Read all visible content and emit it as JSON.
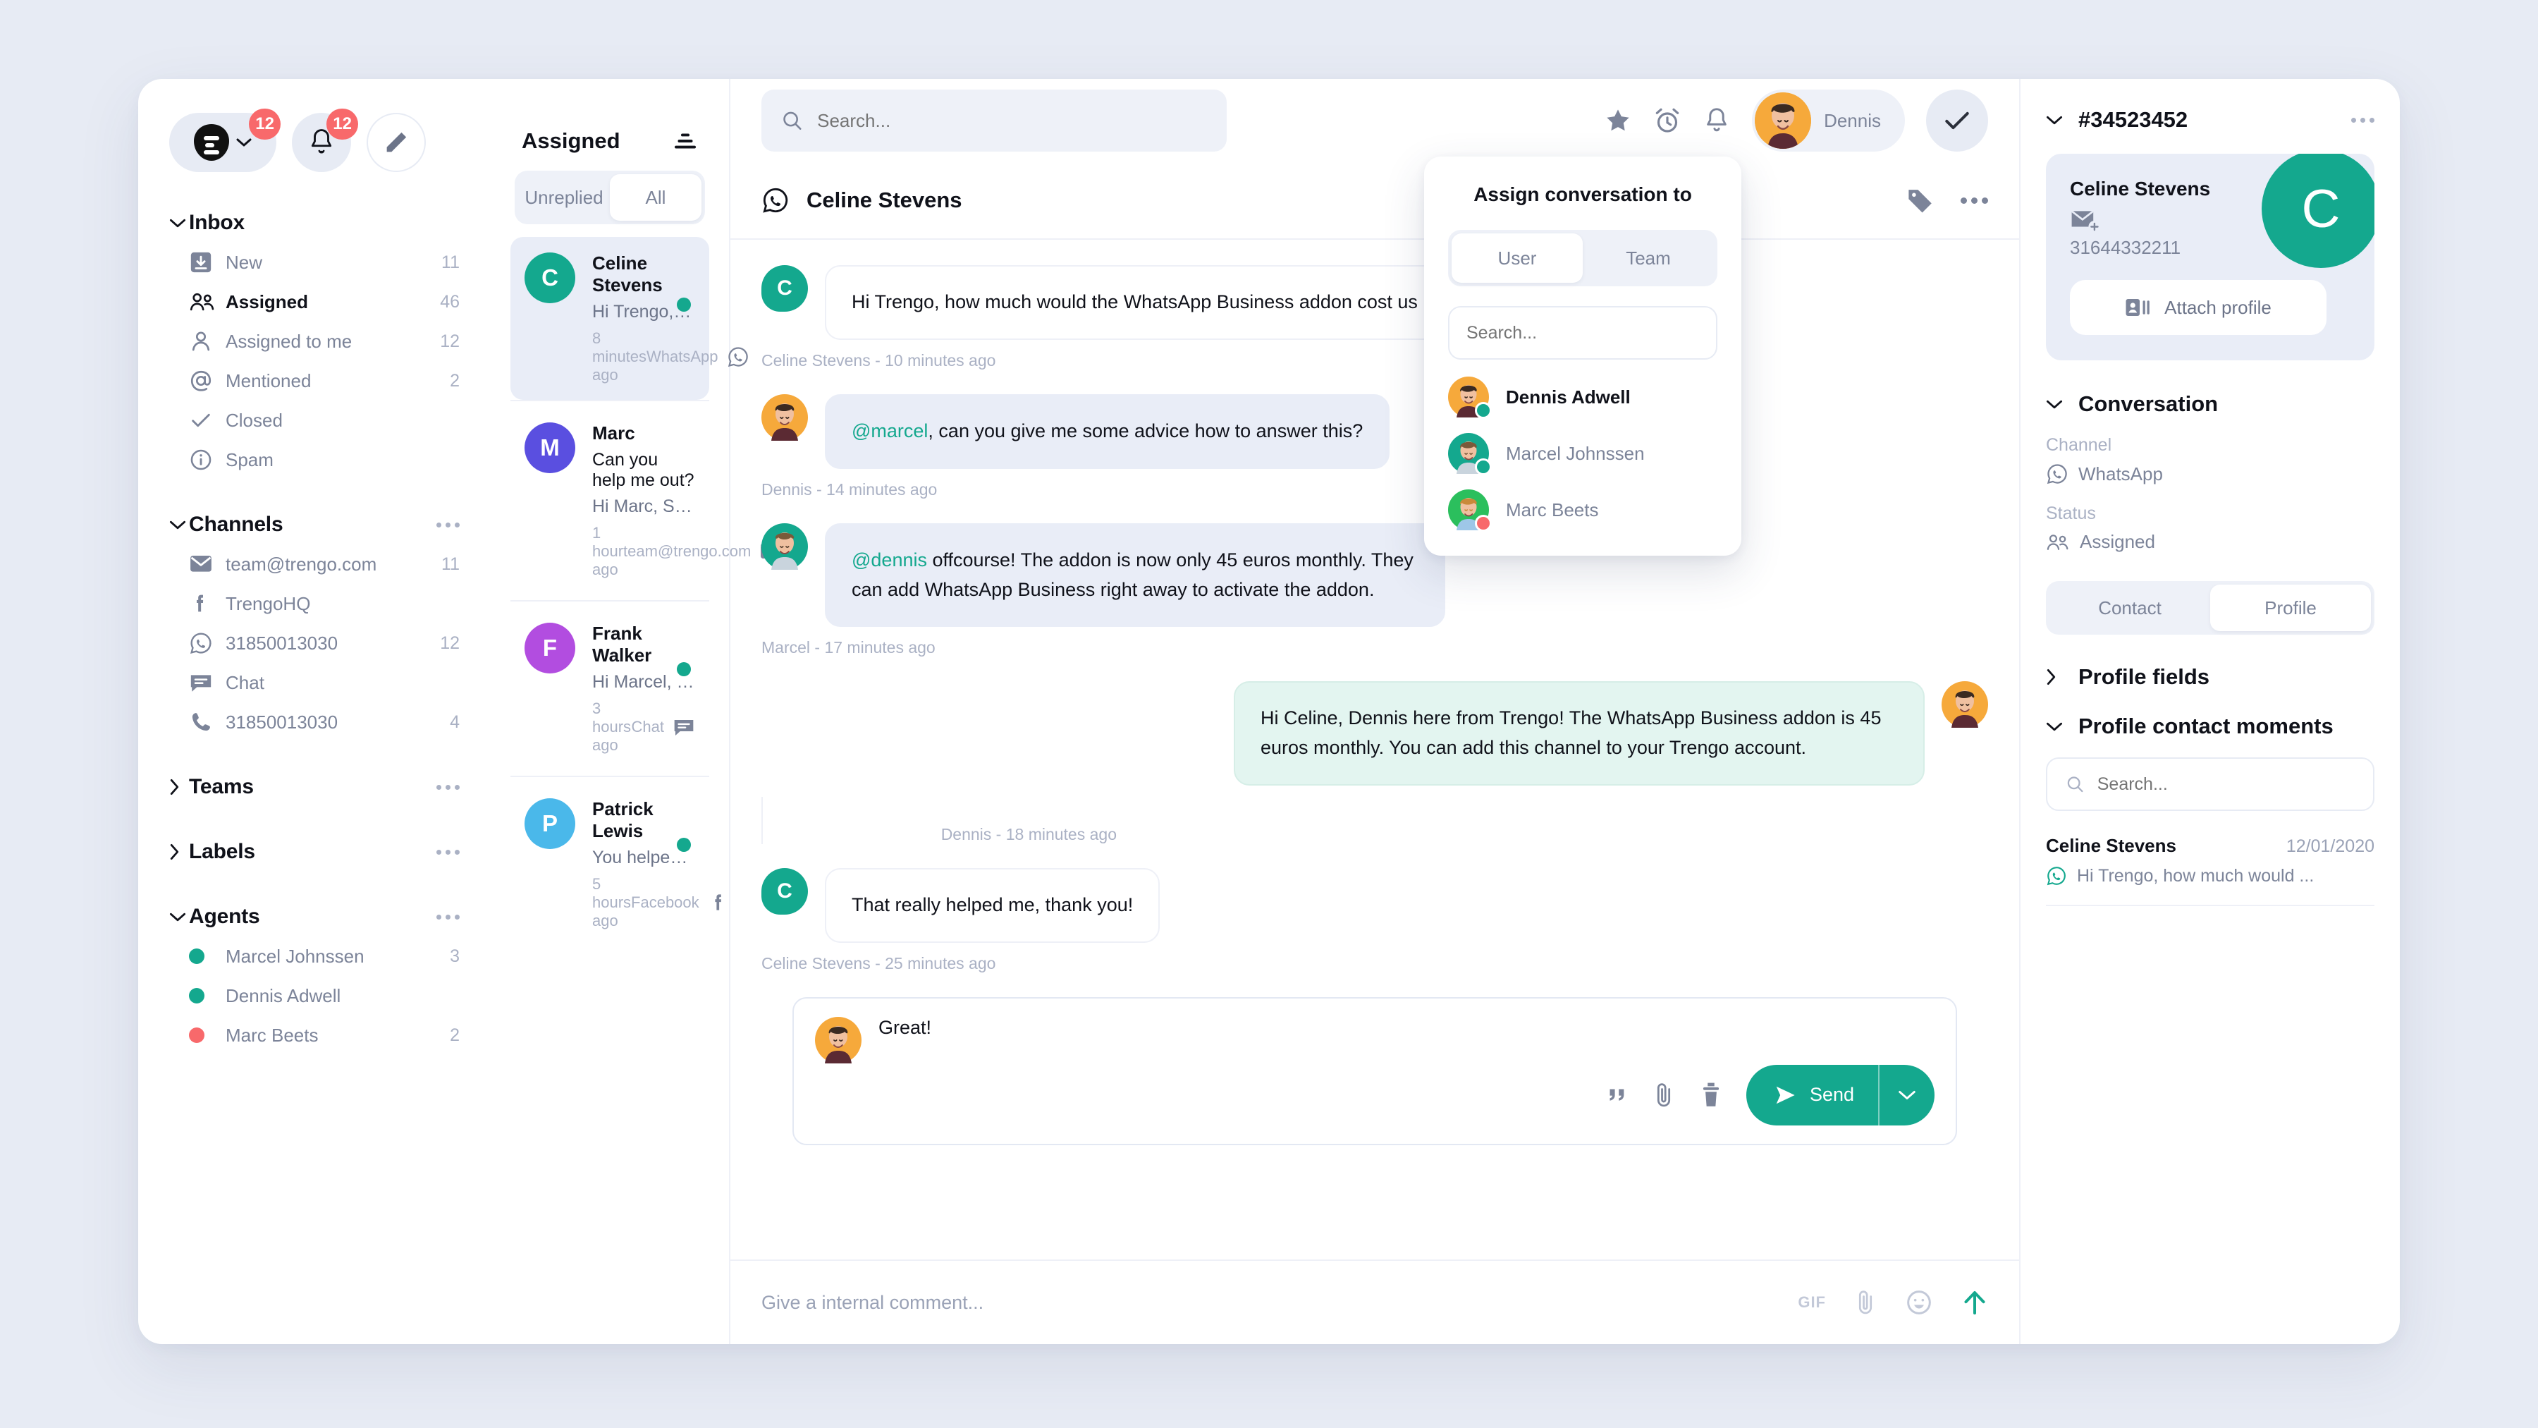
{
  "colors": {
    "accent": "#14a88e",
    "page_bg": "#e7ebf4",
    "badge_red": "#f8696b",
    "outgoing_bubble": "#e3f5f0",
    "note_bubble": "#e9edf7"
  },
  "topnav": {
    "logo_badge": "12",
    "bell_badge": "12",
    "compose_icon": "pencil-icon"
  },
  "search": {
    "placeholder": "Search..."
  },
  "sidebar": {
    "sections": [
      {
        "key": "inbox",
        "title": "Inbox",
        "expanded": true,
        "has_more": false,
        "items": [
          {
            "icon": "inbox-download-icon",
            "label": "New",
            "count": "11",
            "active": false
          },
          {
            "icon": "users-icon",
            "label": "Assigned",
            "count": "46",
            "active": true
          },
          {
            "icon": "user-icon",
            "label": "Assigned to me",
            "count": "12",
            "active": false
          },
          {
            "icon": "at-icon",
            "label": "Mentioned",
            "count": "2",
            "active": false
          },
          {
            "icon": "check-icon",
            "label": "Closed",
            "count": "",
            "active": false
          },
          {
            "icon": "info-icon",
            "label": "Spam",
            "count": "",
            "active": false
          }
        ]
      },
      {
        "key": "channels",
        "title": "Channels",
        "expanded": true,
        "has_more": true,
        "items": [
          {
            "icon": "email-icon",
            "label": "team@trengo.com",
            "count": "11",
            "active": false
          },
          {
            "icon": "facebook-icon",
            "label": "TrengoHQ",
            "count": "",
            "active": false
          },
          {
            "icon": "whatsapp-icon",
            "label": "31850013030",
            "count": "12",
            "active": false
          },
          {
            "icon": "chat-icon",
            "label": "Chat",
            "count": "",
            "active": false
          },
          {
            "icon": "phone-icon",
            "label": "31850013030",
            "count": "4",
            "active": false
          }
        ]
      },
      {
        "key": "teams",
        "title": "Teams",
        "expanded": false,
        "has_more": true,
        "items": []
      },
      {
        "key": "labels",
        "title": "Labels",
        "expanded": false,
        "has_more": true,
        "items": []
      },
      {
        "key": "agents",
        "title": "Agents",
        "expanded": true,
        "has_more": true,
        "items": [
          {
            "icon": "status-dot-online",
            "label": "Marcel Johnssen",
            "count": "3",
            "status_color": "#14a88e"
          },
          {
            "icon": "status-dot-online",
            "label": "Dennis Adwell",
            "count": "",
            "status_color": "#14a88e"
          },
          {
            "icon": "status-dot-away",
            "label": "Marc Beets",
            "count": "2",
            "status_color": "#f8696b"
          }
        ]
      }
    ]
  },
  "conversation_list": {
    "title": "Assigned",
    "sort_icon": "sort-icon",
    "tabs": [
      {
        "label": "Unreplied",
        "selected": false
      },
      {
        "label": "All",
        "selected": true
      }
    ],
    "items": [
      {
        "initial": "C",
        "avatar_color": "#14a88e",
        "name": "Celine Stevens",
        "preview": "Hi Trengo, how much would be t...",
        "time": "8 minutes ago",
        "channel": "WhatsApp",
        "channel_icon": "whatsapp-icon",
        "unread": true,
        "selected": true
      },
      {
        "initial": "M",
        "avatar_color": "#5a4fe0",
        "name": "Marc",
        "subject": "Can you help me out?",
        "preview": "Hi Marc, Sure thing! You can find...",
        "time": "1 hour ago",
        "channel": "team@trengo.com",
        "channel_icon": "email-icon",
        "unread": false,
        "selected": false
      },
      {
        "initial": "F",
        "avatar_color": "#b martin",
        "name": "Frank Walker",
        "preview": "Hi Marcel, thank you so much!",
        "time": "3 hours ago",
        "channel": "Chat",
        "channel_icon": "chat-icon",
        "unread": true,
        "selected": false
      },
      {
        "initial": "P",
        "avatar_color": "#4ab8ea",
        "name": "Patrick Lewis",
        "preview": "You helped me out, appreciated!",
        "time": "5 hours ago",
        "channel": "Facebook",
        "channel_icon": "facebook-icon",
        "unread": true,
        "selected": false
      }
    ]
  },
  "topbar": {
    "icons": [
      "star-icon",
      "alarm-clock-icon",
      "bell-icon"
    ],
    "user_name": "Dennis",
    "resolve_icon": "check-icon"
  },
  "thread": {
    "channel_icon": "whatsapp-icon",
    "contact_name": "Celine Stevens",
    "header_icons": [
      "tag-icon",
      "more-icon"
    ],
    "messages": [
      {
        "type": "in",
        "avatar": "letter",
        "initial": "C",
        "avatar_color": "#14a88e",
        "text": "Hi Trengo, how much would the WhatsApp Business addon cost us monthly?",
        "stamp": "Celine Stevens - 10 minutes ago"
      },
      {
        "type": "note",
        "avatar": "photo-dennis",
        "mention": "@marcel",
        "text": ", can you give me some advice how to answer this?",
        "stamp": "Dennis - 14 minutes ago"
      },
      {
        "type": "note",
        "avatar": "photo-marcel",
        "mention": "@dennis",
        "text": " offcourse! The addon is now only 45 euros monthly. They can add WhatsApp Business right away to activate the addon.",
        "stamp": "Marcel - 17 minutes ago"
      },
      {
        "type": "out",
        "avatar": "photo-dennis",
        "text": "Hi Celine, Dennis here from Trengo! The WhatsApp Business addon is 45 euros monthly. You can add this channel to your Trengo account.",
        "stamp": "Dennis - 18 minutes ago"
      },
      {
        "type": "in",
        "avatar": "letter",
        "initial": "C",
        "avatar_color": "#14a88e",
        "text": "That really helped me, thank you!",
        "stamp": "Celine Stevens - 25 minutes ago"
      }
    ],
    "compose": {
      "draft": "Great!",
      "icons": [
        "quote-icon",
        "paperclip-icon",
        "trash-icon"
      ],
      "send_label": "Send",
      "send_caret_icon": "chevron-down-icon"
    },
    "internal_comment": {
      "placeholder": "Give a internal comment...",
      "icons": [
        "gif-icon",
        "paperclip-icon",
        "emoji-icon",
        "send-up-icon"
      ],
      "gif_label": "GIF"
    }
  },
  "assign_popover": {
    "title": "Assign conversation to",
    "tabs": [
      {
        "label": "User",
        "selected": true
      },
      {
        "label": "Team",
        "selected": false
      }
    ],
    "search_placeholder": "Search...",
    "options": [
      {
        "name": "Dennis Adwell",
        "selected": true,
        "presence": "#14a88e",
        "avatar_color": "#f5a623"
      },
      {
        "name": "Marcel Johnssen",
        "selected": false,
        "presence": "#14a88e",
        "avatar_color": "#14a88e"
      },
      {
        "name": "Marc Beets",
        "selected": false,
        "presence": "#f8696b",
        "avatar_color": "#2bbf5d"
      }
    ]
  },
  "right_panel": {
    "ticket_id": "#34523452",
    "contact": {
      "name": "Celine Stevens",
      "email_icon": "email-add-icon",
      "phone": "31644332211",
      "initial": "C",
      "attach_label": "Attach profile",
      "attach_icon": "contact-card-icon"
    },
    "conversation": {
      "title": "Conversation",
      "channel_label": "Channel",
      "channel_value": "WhatsApp",
      "channel_icon": "whatsapp-icon",
      "status_label": "Status",
      "status_value": "Assigned",
      "status_icon": "users-icon"
    },
    "tabs": [
      {
        "label": "Contact",
        "selected": false
      },
      {
        "label": "Profile",
        "selected": true
      }
    ],
    "profile_fields_title": "Profile fields",
    "contact_moments_title": "Profile contact moments",
    "moments_search_placeholder": "Search...",
    "moments": [
      {
        "name": "Celine Stevens",
        "date": "12/01/2020",
        "preview": "Hi Trengo, how much would ...",
        "channel_icon": "whatsapp-icon"
      }
    ]
  }
}
